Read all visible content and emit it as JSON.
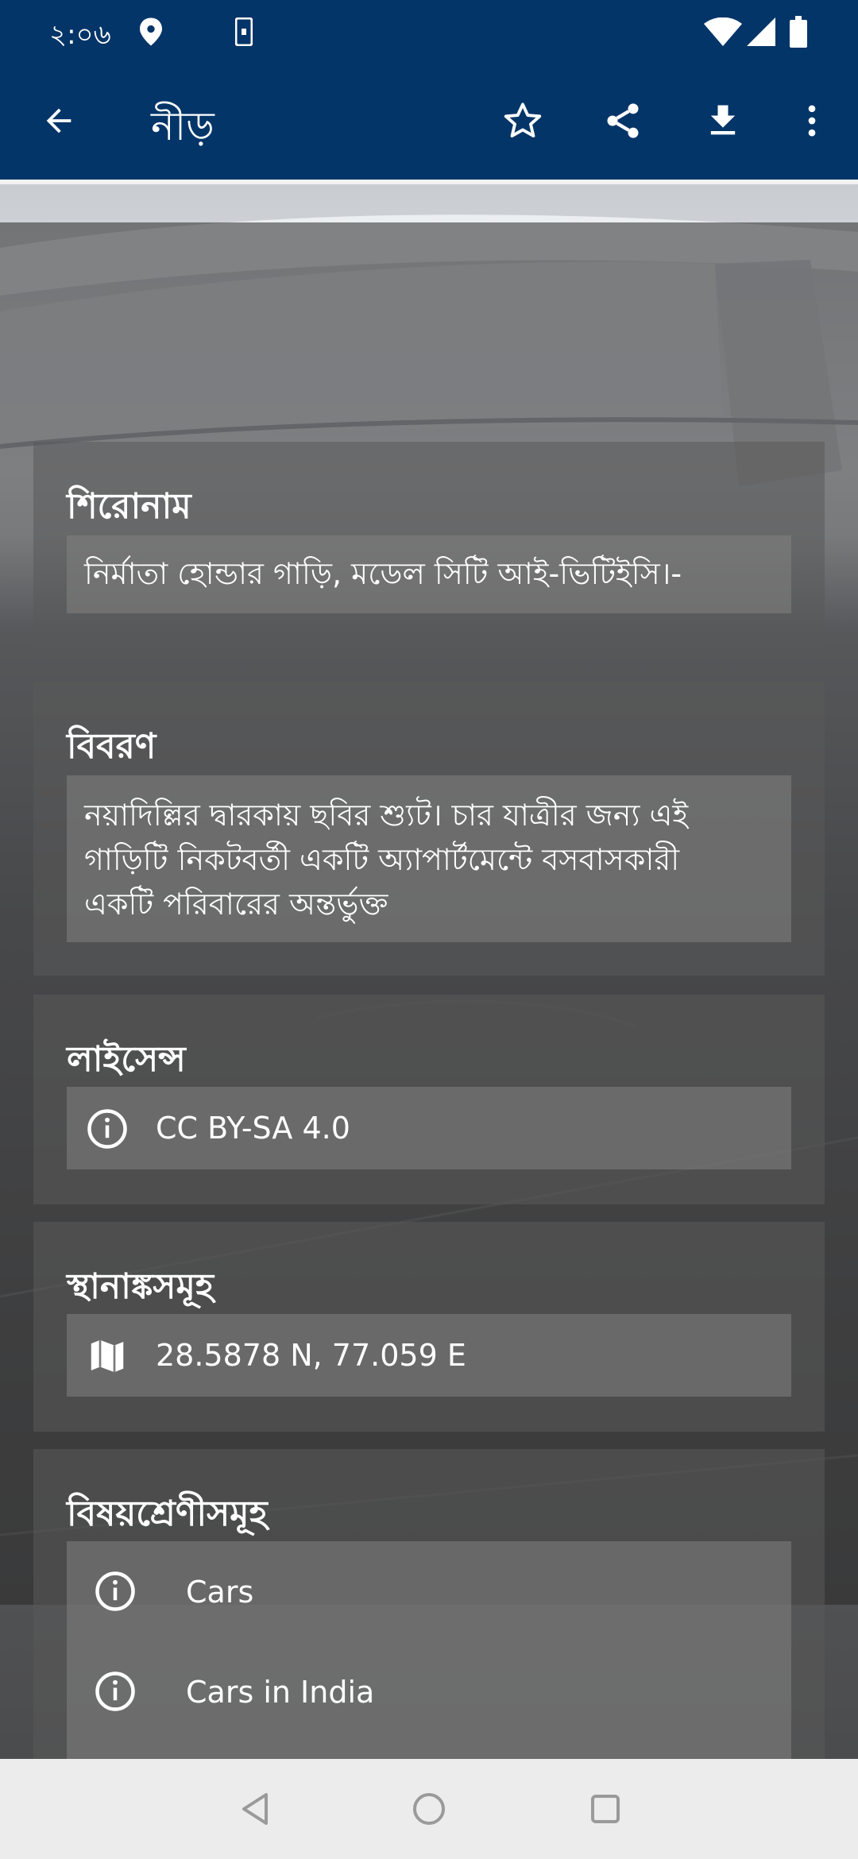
{
  "status_bar": {
    "time": "২:০৬"
  },
  "toolbar": {
    "title": "নীড়"
  },
  "cards": {
    "title": {
      "heading": "শিরোনাম",
      "value": "নির্মাতা হোন্ডার গাড়ি, মডেল সিটি আই-ভিটিইসি।-"
    },
    "description": {
      "heading": "বিবরণ",
      "lines": [
        "নয়াদিল্লির দ্বারকায় ছবির শ্যুট। চার যাত্রীর জন্য এই",
        "গাড়িটি নিকটবর্তী একটি অ্যাপার্টমেন্টে বসবাসকারী",
        "একটি পরিবারের অন্তর্ভুক্ত"
      ]
    },
    "license": {
      "heading": "লাইসেন্স",
      "value": "CC BY-SA 4.0"
    },
    "coordinates": {
      "heading": "স্থানাঙ্কসমূহ",
      "value": "28.5878 N, 77.059 E"
    },
    "categories": {
      "heading": "বিষয়শ্রেণীসমূহ",
      "items": [
        "Cars",
        "Cars in India"
      ]
    }
  },
  "icons": {
    "back": "arrow-left-icon",
    "star": "star-outline-icon",
    "share": "share-icon",
    "download": "download-icon",
    "more": "more-vert-icon",
    "info": "info-icon",
    "map": "map-icon"
  },
  "colors": {
    "app_bar": "#033568",
    "nav_bar": "#ececec"
  }
}
